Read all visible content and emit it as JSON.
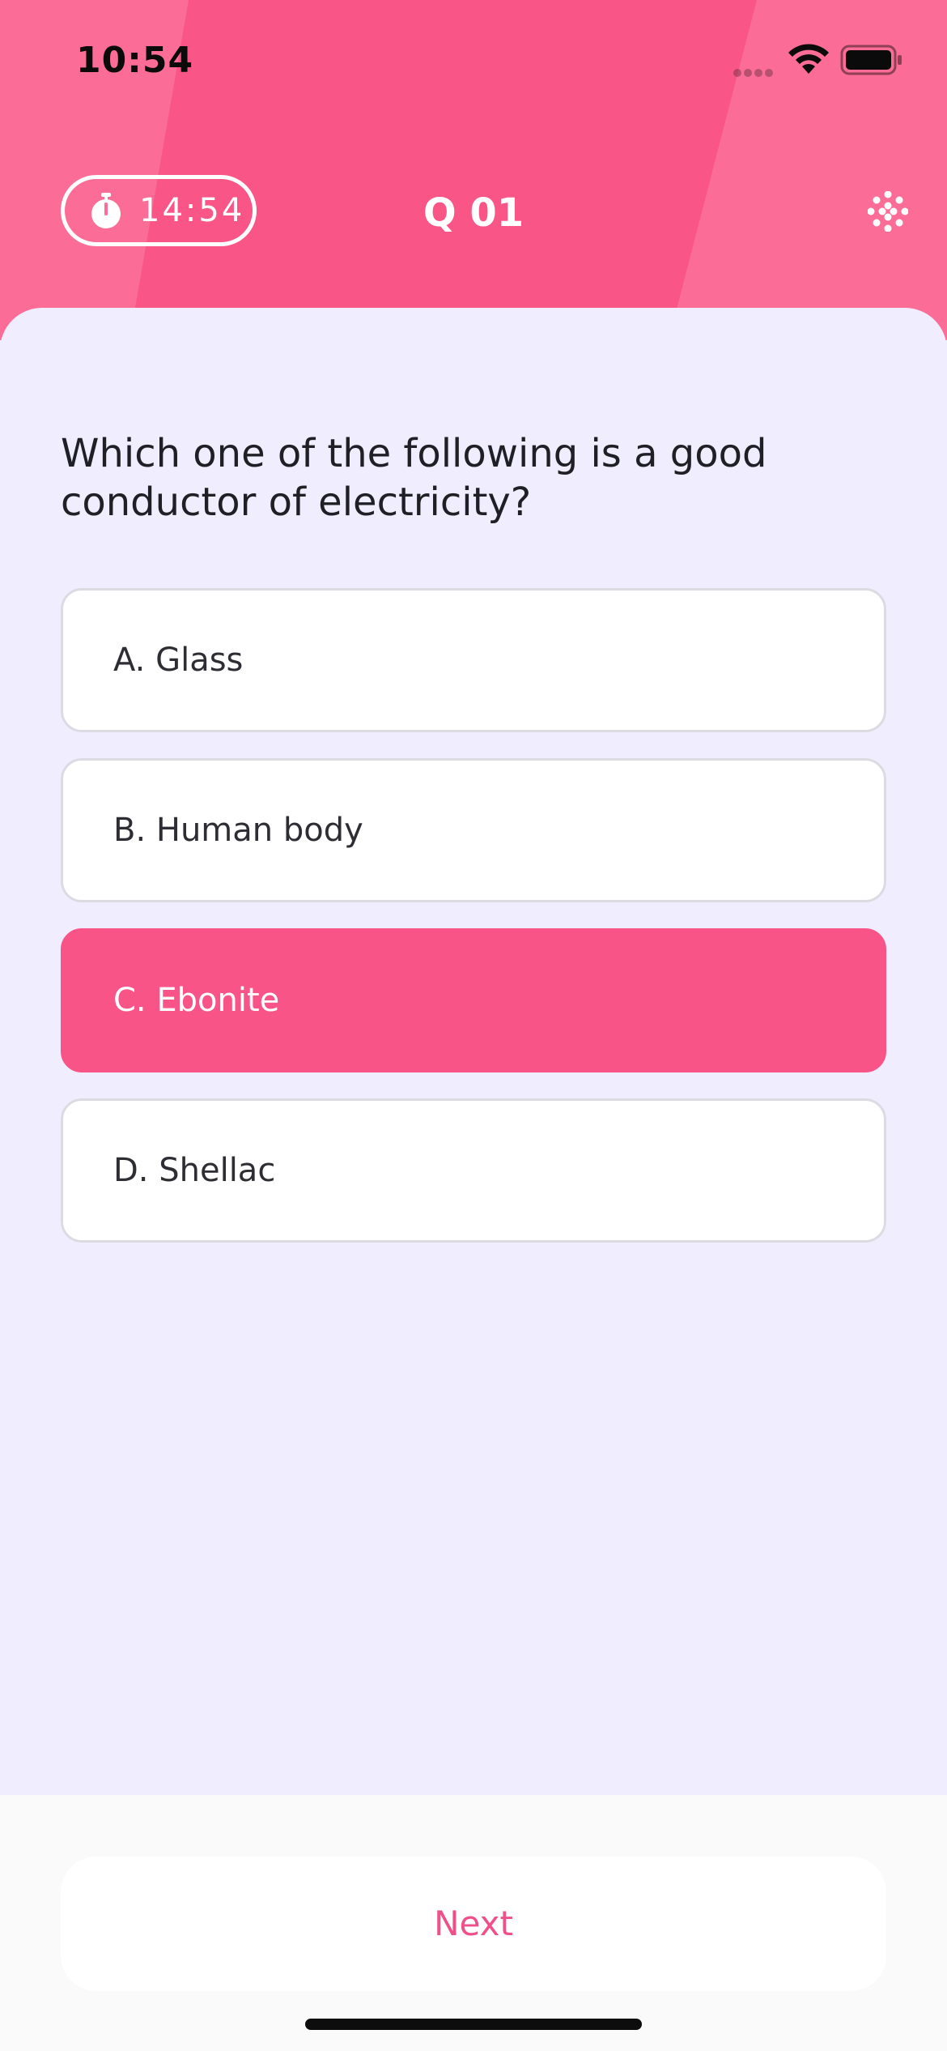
{
  "status_bar": {
    "time": "10:54",
    "signal_icon": "signal-dots-icon",
    "wifi_icon": "wifi-icon",
    "battery_icon": "battery-icon"
  },
  "header": {
    "timer": "14:54",
    "timer_icon": "stopwatch-icon",
    "question_number": "Q 01",
    "grid_icon": "dot-grid-icon",
    "colors": {
      "header_bg": "#fb6c96",
      "header_band": "#f95687"
    }
  },
  "question": {
    "text": "Which one of the following is a good conductor of electricity?"
  },
  "options": [
    {
      "label": "A. Glass",
      "selected": false
    },
    {
      "label": "B. Human body",
      "selected": false
    },
    {
      "label": "C. Ebonite",
      "selected": true
    },
    {
      "label": "D. Shellac",
      "selected": false
    }
  ],
  "footer": {
    "next_label": "Next"
  },
  "theme": {
    "accent": "#f95487",
    "content_bg": "#f0edfe"
  }
}
